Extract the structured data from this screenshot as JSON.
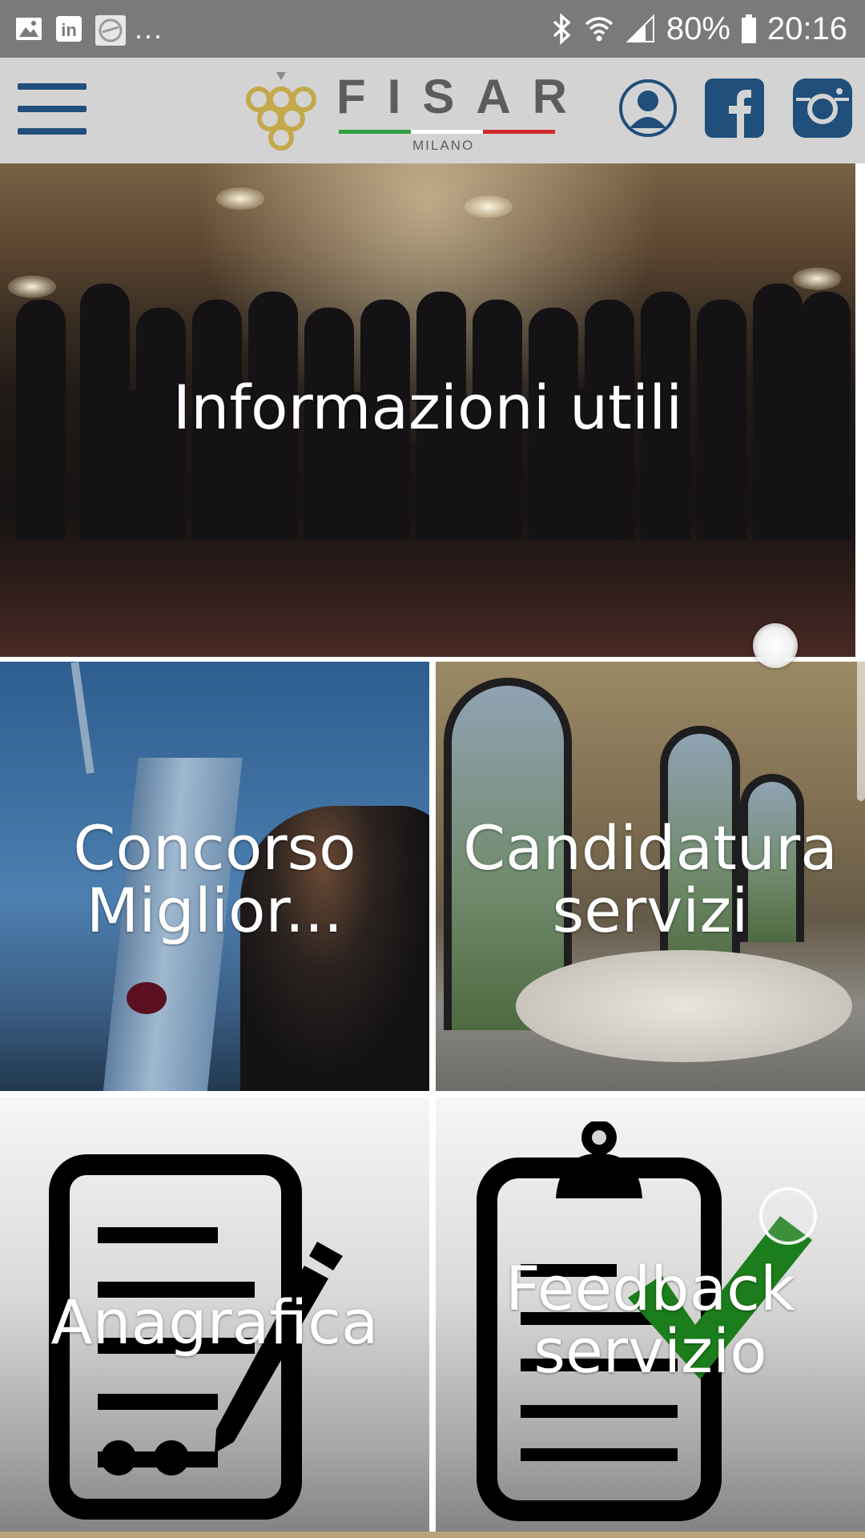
{
  "status_bar": {
    "left_icons": [
      "image-icon",
      "linkedin-icon",
      "app-thumbnail-icon"
    ],
    "overflow": "...",
    "battery": "80%",
    "time": "20:16"
  },
  "header": {
    "logo": {
      "brand": "FISAR",
      "sub": "MILANO",
      "flag_colors": [
        "#2e9e3f",
        "#ffffff",
        "#d12a2a"
      ]
    },
    "icons": [
      "profile-icon",
      "facebook-icon",
      "instagram-icon"
    ],
    "accent": "#1f4f7a"
  },
  "tiles": {
    "hero": {
      "label": "Informazioni utili"
    },
    "concorso": {
      "line1": "Concorso",
      "line2": "Miglior..."
    },
    "candidatura": {
      "line1": "Candidatura",
      "line2": "servizi"
    },
    "anagrafica": {
      "label": "Anagrafica"
    },
    "feedback": {
      "line1": "Feedback",
      "line2": "servizio"
    }
  }
}
